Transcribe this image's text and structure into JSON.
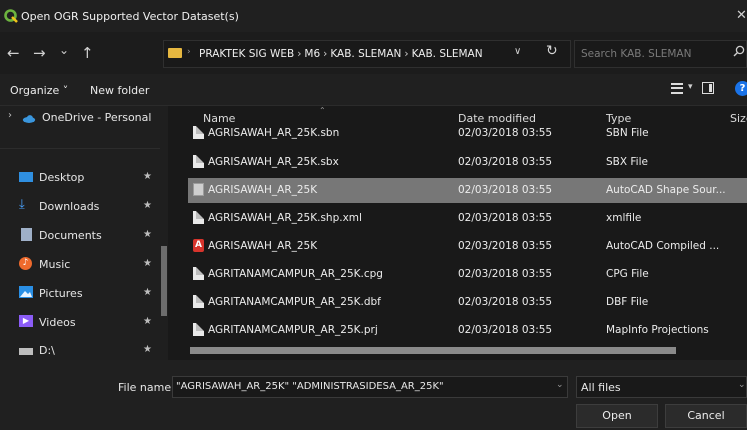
{
  "window": {
    "title": "Open OGR Supported Vector Dataset(s)",
    "close_glyph": "✕"
  },
  "nav": {
    "back": "←",
    "forward": "→",
    "recent": "⌄",
    "up": "↑"
  },
  "path": {
    "segments": [
      "PRAKTEK SIG WEB",
      "M6",
      "KAB. SLEMAN",
      "KAB. SLEMAN"
    ],
    "refresh": "↻",
    "dropdown": "∨"
  },
  "search": {
    "placeholder": "Search KAB. SLEMAN",
    "icon": "search-icon"
  },
  "toolbar": {
    "organize": "Organize ˅",
    "new_folder": "New folder",
    "help": "?"
  },
  "sidebar": {
    "items": [
      {
        "label": "OneDrive - Personal",
        "icon": "cloud-icon",
        "color": "#3a96dd"
      },
      {
        "label": "Desktop",
        "icon": "desktop-icon",
        "color": "#2f8fe0"
      },
      {
        "label": "Downloads",
        "icon": "download-icon",
        "color": "#4aa3ff"
      },
      {
        "label": "Documents",
        "icon": "documents-icon",
        "color": "#9fb0c8"
      },
      {
        "label": "Music",
        "icon": "music-icon",
        "color": "#ee6a2d"
      },
      {
        "label": "Pictures",
        "icon": "pictures-icon",
        "color": "#2a8fe5"
      },
      {
        "label": "Videos",
        "icon": "videos-icon",
        "color": "#8b5cf6"
      },
      {
        "label": "D:\\",
        "icon": "drive-icon",
        "color": "#bdbdbd"
      }
    ],
    "pin": "★"
  },
  "columns": {
    "name": "Name",
    "date": "Date modified",
    "type": "Type",
    "size": "Size"
  },
  "files": [
    {
      "name": "AGRISAWAH_AR_25K.sbn",
      "date": "02/03/2018 03:55",
      "type": "SBN File",
      "icon": "file-icon",
      "selected": false
    },
    {
      "name": "AGRISAWAH_AR_25K.sbx",
      "date": "02/03/2018 03:55",
      "type": "SBX File",
      "icon": "file-icon",
      "selected": false
    },
    {
      "name": "AGRISAWAH_AR_25K",
      "date": "02/03/2018 03:55",
      "type": "AutoCAD Shape Sour...",
      "icon": "shape-file-icon",
      "selected": true
    },
    {
      "name": "AGRISAWAH_AR_25K.shp.xml",
      "date": "02/03/2018 03:55",
      "type": "xmlfile",
      "icon": "file-icon",
      "selected": false
    },
    {
      "name": "AGRISAWAH_AR_25K",
      "date": "02/03/2018 03:55",
      "type": "AutoCAD Compiled ...",
      "icon": "autocad-icon",
      "selected": false
    },
    {
      "name": "AGRITANAMCAMPUR_AR_25K.cpg",
      "date": "02/03/2018 03:55",
      "type": "CPG File",
      "icon": "file-icon",
      "selected": false
    },
    {
      "name": "AGRITANAMCAMPUR_AR_25K.dbf",
      "date": "02/03/2018 03:55",
      "type": "DBF File",
      "icon": "file-icon",
      "selected": false
    },
    {
      "name": "AGRITANAMCAMPUR_AR_25K.prj",
      "date": "02/03/2018 03:55",
      "type": "MapInfo Projections",
      "icon": "file-icon",
      "selected": false
    }
  ],
  "footer": {
    "file_name_label": "File name:",
    "file_name_value": "\"AGRISAWAH_AR_25K\" \"ADMINISTRASIDESA_AR_25K\"",
    "filter": "All files",
    "open": "Open",
    "cancel": "Cancel"
  },
  "colors": {
    "accent": "#1a73e8",
    "selected_row": "#777777",
    "qgis_green": "#6db33f"
  }
}
